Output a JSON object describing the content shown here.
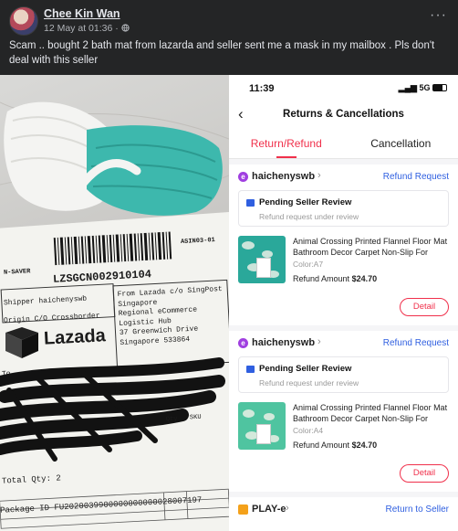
{
  "post": {
    "author": "Chee Kin Wan",
    "date": "12 May at 01:36",
    "privacy_icon": "globe-icon",
    "more_label": "···",
    "text": "Scam .. bought 2 bath mat from lazarda and seller sent me a mask in my mailbox . Pls don't deal with this seller"
  },
  "photo": {
    "barcode_text": "LZSGCN002910104",
    "asin": "ASIN03-01",
    "n_saver": "N-SAVER",
    "shipper": "Shipper  haichenyswb",
    "origin": "Origin  C/O Crossborder",
    "from_lines": [
      "From  Lazada c/o SingPost",
      "Singapore",
      "Regional eCommerce",
      "Logistic Hub",
      "37 Greenwich Drive",
      "Singapore 533864"
    ],
    "brand": "Lazada",
    "to_label": "To",
    "qty_label": "Qty",
    "sku_label": "SKU",
    "total_qty": "Total Qty: 2",
    "package_id": "Package ID  FU2020039900000000000028007197"
  },
  "phone": {
    "time": "11:39",
    "signal": "5G",
    "title": "Returns & Cancellations",
    "tabs": [
      "Return/Refund",
      "Cancellation"
    ],
    "orders": [
      {
        "shop": "haichenyswb",
        "status": "Refund Request",
        "review_title": "Pending Seller Review",
        "review_sub": "Refund request under review",
        "product_name": "Animal Crossing Printed Flannel Floor Mat Bathroom Decor Carpet Non-Slip For",
        "color": "Color:A7",
        "refund_label": "Refund Amount",
        "refund_amount": "$24.70",
        "detail": "Detail"
      },
      {
        "shop": "haichenyswb",
        "status": "Refund Request",
        "review_title": "Pending Seller Review",
        "review_sub": "Refund request under review",
        "product_name": "Animal Crossing Printed Flannel Floor Mat Bathroom Decor Carpet Non-Slip For",
        "color": "Color:A4",
        "refund_label": "Refund Amount",
        "refund_amount": "$24.70",
        "detail": "Detail"
      }
    ],
    "order3": {
      "shop": "PLAY-e",
      "status": "Return to Seller"
    }
  }
}
